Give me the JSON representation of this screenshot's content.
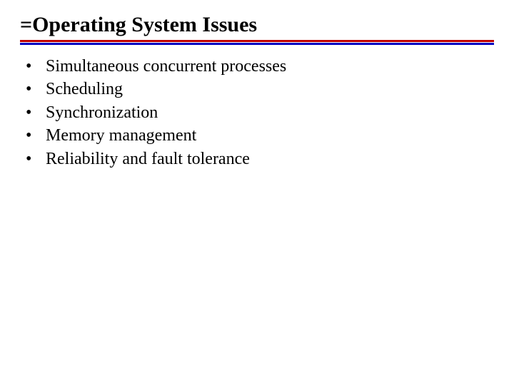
{
  "title": "=Operating System Issues",
  "bullets": [
    "Simultaneous concurrent processes",
    "Scheduling",
    "Synchronization",
    "Memory management",
    "Reliability and fault tolerance"
  ],
  "colors": {
    "red": "#c00000",
    "blue": "#0000c0"
  }
}
